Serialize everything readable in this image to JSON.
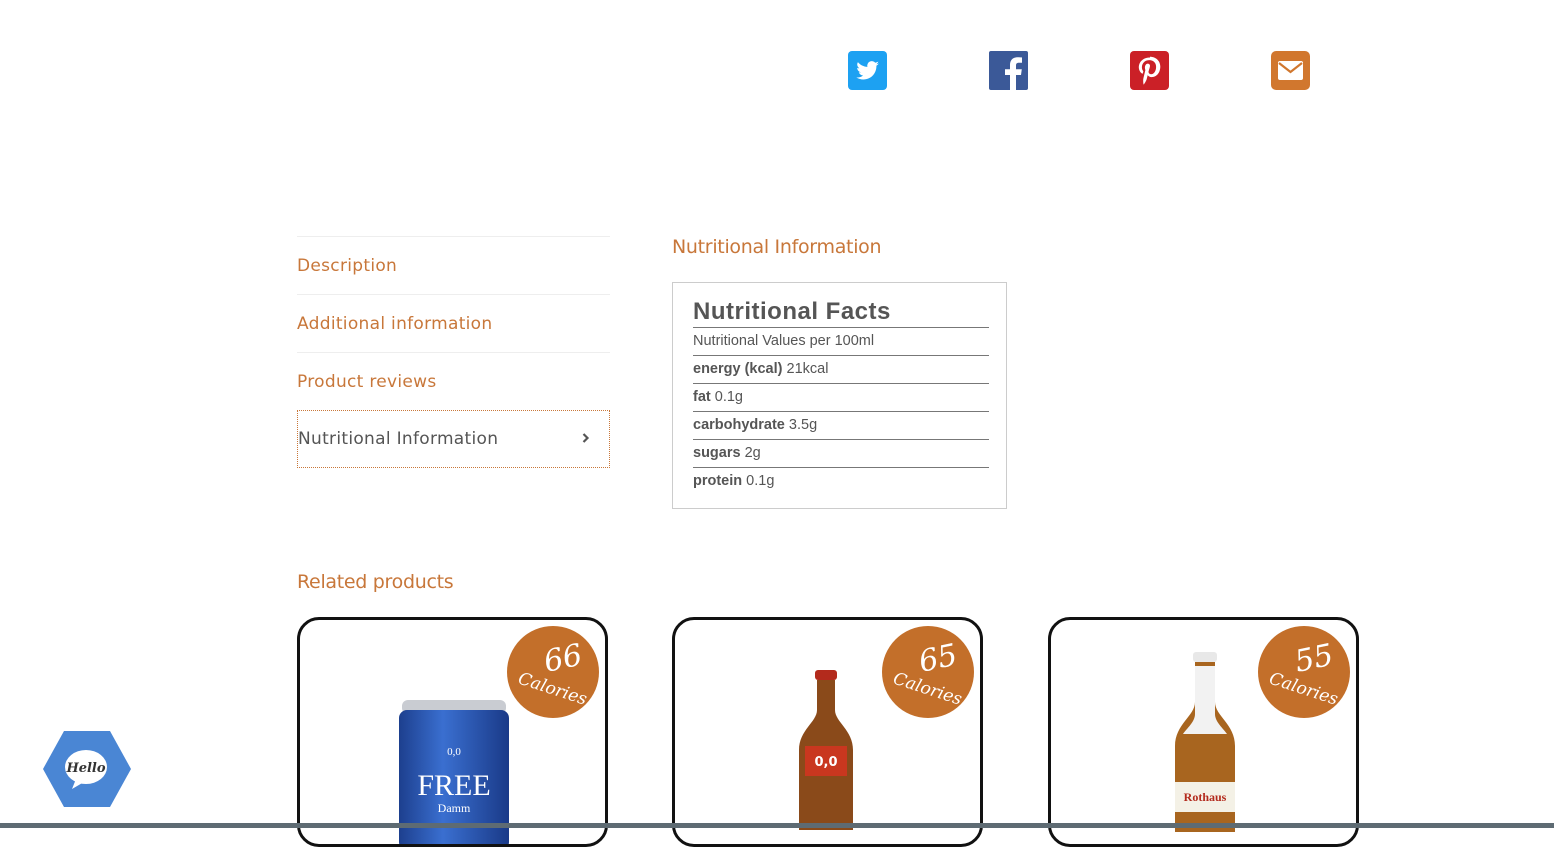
{
  "share": {
    "icons": [
      "twitter-icon",
      "facebook-icon",
      "pinterest-icon",
      "email-icon"
    ],
    "colors": {
      "twitter": "#1da1f2",
      "facebook": "#3b5998",
      "pinterest": "#cb2027",
      "email": "#d1772e"
    }
  },
  "tabs": [
    {
      "label": "Description"
    },
    {
      "label": "Additional information"
    },
    {
      "label": "Product reviews"
    },
    {
      "label": "Nutritional Information"
    }
  ],
  "nutrition": {
    "heading": "Nutritional Information",
    "title": "Nutritional Facts",
    "subtitle": "Nutritional Values per 100ml",
    "rows": [
      {
        "name": "energy (kcal)",
        "value": "21kcal"
      },
      {
        "name": "fat",
        "value": "0.1g"
      },
      {
        "name": "carbohydrate",
        "value": "3.5g"
      },
      {
        "name": "sugars",
        "value": "2g"
      },
      {
        "name": "protein",
        "value": "0.1g"
      }
    ]
  },
  "related": {
    "heading": "Related products",
    "products": [
      {
        "calories": "66",
        "calories_label": "Calories"
      },
      {
        "calories": "65",
        "calories_label": "Calories"
      },
      {
        "calories": "55",
        "calories_label": "Calories"
      }
    ]
  },
  "chat": {
    "label": "Hello"
  },
  "accent_color": "#c8773a"
}
